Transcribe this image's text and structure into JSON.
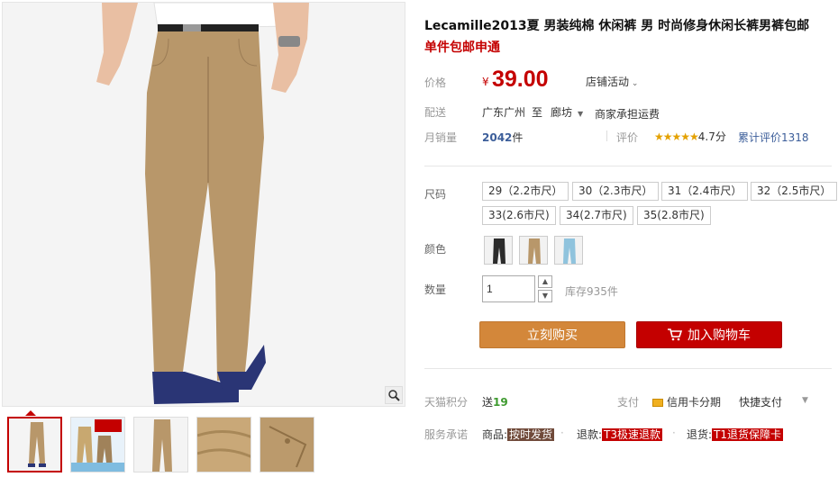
{
  "product": {
    "title": "Lecamille2013夏 男装纯棉 休闲裤 男 时尚修身休闲长裤男裤包邮",
    "subtitle": "单件包邮申通"
  },
  "price": {
    "label": "价格",
    "currency": "¥",
    "value": "39.00",
    "activity": "店铺活动"
  },
  "shipping": {
    "label": "配送",
    "from": "广东广州",
    "to_word": "至",
    "to": "廊坊",
    "fee": "商家承担运费"
  },
  "sales": {
    "label": "月销量",
    "count": "2042",
    "unit": "件",
    "review_label": "评价",
    "stars": "★★★★★",
    "rating": "4.7分",
    "total_reviews": "累计评价1318"
  },
  "sizes": {
    "label": "尺码",
    "options": [
      "29（2.2市尺）",
      "30（2.3市尺）",
      "31（2.4市尺）",
      "32（2.5市尺）",
      "33(2.6市尺)",
      "34(2.7市尺)",
      "35(2.8市尺)"
    ]
  },
  "colors": {
    "label": "颜色"
  },
  "quantity": {
    "label": "数量",
    "value": "1",
    "stock": "库存935件"
  },
  "buttons": {
    "buy_now": "立刻购买",
    "add_cart": "加入购物车"
  },
  "points": {
    "label": "天猫积分",
    "prefix": "送",
    "amount": "19"
  },
  "payment": {
    "label": "支付",
    "credit": "信用卡分期",
    "quick": "快捷支付"
  },
  "services": {
    "label": "服务承诺",
    "goods_prefix": "商品:",
    "goods_tag": "按时发货",
    "refund_prefix": "退款:",
    "refund_tag": "T3极速退款",
    "return_prefix": "退货:",
    "return_tag": "T1退货保障卡"
  },
  "colors_palette": {
    "accent": "#c40000",
    "buy_button": "#d3873a",
    "khaki": "#b8976a"
  }
}
